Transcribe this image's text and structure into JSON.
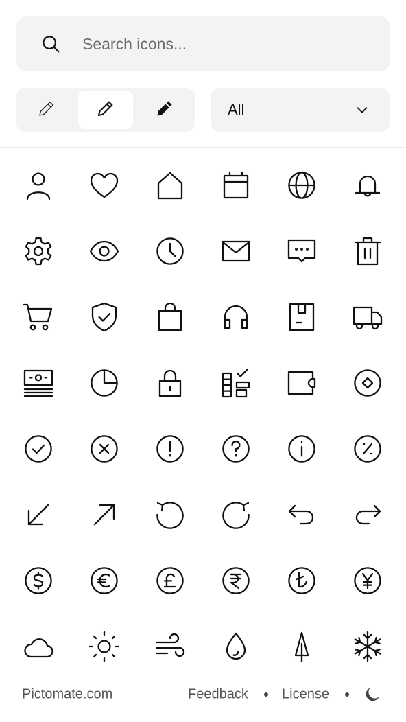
{
  "search": {
    "placeholder": "Search icons...",
    "value": "",
    "icon": "search-icon"
  },
  "weight_toggle": {
    "options": [
      {
        "name": "thin",
        "icon": "pencil-thin-icon",
        "selected": false
      },
      {
        "name": "regular",
        "icon": "pencil-regular-icon",
        "selected": true
      },
      {
        "name": "solid",
        "icon": "pencil-solid-icon",
        "selected": false
      }
    ]
  },
  "category_select": {
    "value": "All",
    "icon": "chevron-down-icon"
  },
  "icons": [
    "user-icon",
    "heart-icon",
    "home-icon",
    "calendar-icon",
    "globe-icon",
    "bell-icon",
    "gear-icon",
    "eye-icon",
    "clock-icon",
    "mail-icon",
    "chat-icon",
    "trash-icon",
    "cart-icon",
    "shield-check-icon",
    "shopping-bag-icon",
    "headphones-icon",
    "package-icon",
    "truck-icon",
    "banknote-icon",
    "pie-chart-icon",
    "lock-icon",
    "tasks-icon",
    "wallet-icon",
    "diamond-circle-icon",
    "check-circle-icon",
    "x-circle-icon",
    "exclamation-circle-icon",
    "question-circle-icon",
    "info-circle-icon",
    "percent-circle-icon",
    "arrow-down-left-icon",
    "arrow-up-right-icon",
    "rotate-ccw-icon",
    "rotate-cw-icon",
    "undo-icon",
    "redo-icon",
    "dollar-circle-icon",
    "euro-circle-icon",
    "pound-circle-icon",
    "rupee-circle-icon",
    "lira-circle-icon",
    "yen-circle-icon",
    "cloud-icon",
    "sun-icon",
    "wind-icon",
    "droplet-icon",
    "tree-icon",
    "snowflake-icon"
  ],
  "footer": {
    "site": "Pictomate.com",
    "feedback": "Feedback",
    "license": "License",
    "theme_icon": "moon-icon"
  },
  "colors": {
    "surface": "#f3f3f3",
    "stroke": "#111111",
    "muted_text": "#555555"
  }
}
